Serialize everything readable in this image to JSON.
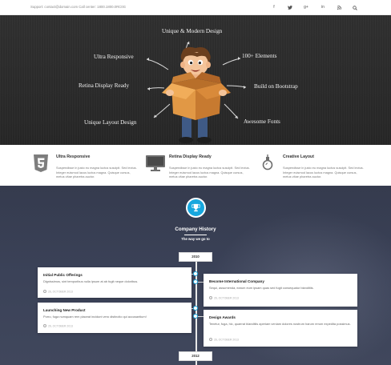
{
  "topbar": {
    "support_text": "Support: contact@domain.com  Call center: 1800.1800.0RC0G",
    "social": [
      {
        "icon": "facebook-icon",
        "glyph": "f"
      },
      {
        "icon": "twitter-icon",
        "glyph": "♥"
      },
      {
        "icon": "google-plus-icon",
        "glyph": "g+"
      },
      {
        "icon": "linkedin-icon",
        "glyph": "in"
      },
      {
        "icon": "rss-icon",
        "glyph": "≈"
      },
      {
        "icon": "search-icon",
        "glyph": ""
      }
    ]
  },
  "hero": {
    "features": {
      "top": "Unique & Modern Design",
      "upper_left": "Ultra Responsive",
      "upper_right": "100+ Elements",
      "middle_left": "Retina Display Ready",
      "middle_right": "Build on Bootstrap",
      "lower_left": "Unique Layout Design",
      "lower_right": "Awesome Fonts"
    },
    "illustration": "boy-holding-open-box"
  },
  "features": [
    {
      "icon": "html5-icon",
      "title": "Ultra Responsive",
      "text": "Suspendisse in justo eu magna luctus suscipit. Sed lectus. Integer euismod lacus luctus magna. Quisque cursus, metus vitae pharetra auctor."
    },
    {
      "icon": "monitor-icon",
      "title": "Retina Display Ready",
      "text": "Suspendisse in justo eu magna luctus suscipit. Sed lectus. Integer euismod lacus luctus magna. Quisque cursus, metus vitae pharetra auctor."
    },
    {
      "icon": "lightbulb-icon",
      "title": "Creative Layout",
      "text": "Suspendisse in justo eu magna luctus suscipit. Sed lectus. Integer euismod lacus luctus magna. Quisque cursus, metus vitae pharetra auctor."
    }
  ],
  "history": {
    "icon": "trophy-icon",
    "title": "Company History",
    "subtitle": "The way we go to",
    "years": [
      "2010",
      "2012"
    ],
    "events": [
      {
        "title": "Initial Public Offerings",
        "text": "Dignissimos, sint temporibus nulla ipsum at ab fugit neque doloribus.",
        "date": "26, OCTOBER 2013"
      },
      {
        "title": "Become International Company",
        "text": "Sequi, assumenda, earum eum ipsam quas sed fugit consequatur blanditiis.",
        "date": "26, OCTOBER 2013"
      },
      {
        "title": "Launching New Product",
        "text": "Porro, fuga numquam rem placeat incidunt vero distinctio qui accusantium!",
        "date": "26, OCTOBER 2013"
      },
      {
        "title": "Design Awards",
        "text": "Tenetur, fuga, hic, quaerat blanditiis aperiam veniam dolores nostrum harum rerum expedita possimus.",
        "date": "26, OCTOBER 2013"
      }
    ]
  },
  "colors": {
    "accent": "#18a8df",
    "hero_bg": "#2d2d2d",
    "history_bg": "#3b4258"
  }
}
